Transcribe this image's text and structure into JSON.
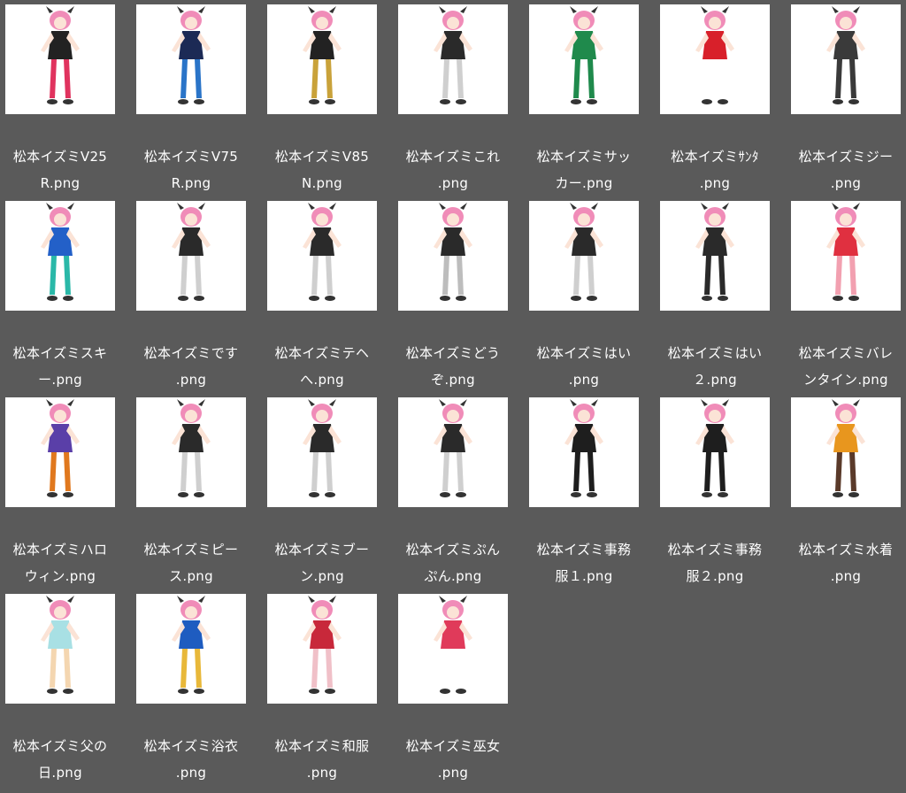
{
  "files": [
    {
      "line1": "松本イズミV25",
      "line2": "R.png",
      "icon": "character-illustration-icon",
      "hair": "#f08cb8",
      "outfit": "#222222",
      "accent": "#e0335e",
      "bg": "#ffffff"
    },
    {
      "line1": "松本イズミV75",
      "line2": "R.png",
      "icon": "character-illustration-icon",
      "hair": "#f08cb8",
      "outfit": "#1c2a55",
      "accent": "#2a74c8",
      "bg": "#ffffff"
    },
    {
      "line1": "松本イズミV85",
      "line2": "N.png",
      "icon": "character-illustration-icon",
      "hair": "#f08cb8",
      "outfit": "#222222",
      "accent": "#c9a23a",
      "bg": "#ffffff"
    },
    {
      "line1": "松本イズミこれ",
      "line2": ".png",
      "icon": "character-illustration-icon",
      "hair": "#f08cb8",
      "outfit": "#2a2a2a",
      "accent": "#cfcfcf",
      "bg": "#ffffff"
    },
    {
      "line1": "松本イズミサッ",
      "line2": "カー.png",
      "icon": "character-illustration-icon",
      "hair": "#f08cb8",
      "outfit": "#1f8a4c",
      "accent": "#1f8a4c",
      "bg": "#ffffff"
    },
    {
      "line1": "松本イズミｻﾝﾀ",
      "line2": ".png",
      "icon": "character-illustration-icon",
      "hair": "#f08cb8",
      "outfit": "#d8202a",
      "accent": "#ffffff",
      "bg": "#ffffff"
    },
    {
      "line1": "松本イズミジー",
      "line2": ".png",
      "icon": "character-illustration-icon",
      "hair": "#f08cb8",
      "outfit": "#3a3a3a",
      "accent": "#3a3a3a",
      "bg": "#ffffff"
    },
    {
      "line1": "松本イズミスキ",
      "line2": "ー.png",
      "icon": "character-illustration-icon",
      "hair": "#f08cb8",
      "outfit": "#2360c8",
      "accent": "#2ab8a8",
      "bg": "#ffffff"
    },
    {
      "line1": "松本イズミです",
      "line2": ".png",
      "icon": "character-illustration-icon",
      "hair": "#f08cb8",
      "outfit": "#2a2a2a",
      "accent": "#cfcfcf",
      "bg": "#ffffff"
    },
    {
      "line1": "松本イズミテヘ",
      "line2": "へ.png",
      "icon": "character-illustration-icon",
      "hair": "#f08cb8",
      "outfit": "#2a2a2a",
      "accent": "#cfcfcf",
      "bg": "#ffffff"
    },
    {
      "line1": "松本イズミどう",
      "line2": "ぞ.png",
      "icon": "character-illustration-icon",
      "hair": "#f08cb8",
      "outfit": "#2a2a2a",
      "accent": "#bdbdbd",
      "bg": "#ffffff"
    },
    {
      "line1": "松本イズミはい",
      "line2": ".png",
      "icon": "character-illustration-icon",
      "hair": "#f08cb8",
      "outfit": "#2a2a2a",
      "accent": "#cfcfcf",
      "bg": "#ffffff"
    },
    {
      "line1": "松本イズミはい",
      "line2": "２.png",
      "icon": "character-illustration-icon",
      "hair": "#f08cb8",
      "outfit": "#2a2a2a",
      "accent": "#2a2a2a",
      "bg": "#ffffff"
    },
    {
      "line1": "松本イズミバレ",
      "line2": "ンタイン.png",
      "icon": "character-illustration-icon",
      "hair": "#f08cb8",
      "outfit": "#e03040",
      "accent": "#f2a0b0",
      "bg": "#ffffff"
    },
    {
      "line1": "松本イズミハロ",
      "line2": "ウィン.png",
      "icon": "character-illustration-icon",
      "hair": "#f08cb8",
      "outfit": "#5a3fa8",
      "accent": "#e0781e",
      "bg": "#ffffff"
    },
    {
      "line1": "松本イズミピー",
      "line2": "ス.png",
      "icon": "character-illustration-icon",
      "hair": "#f08cb8",
      "outfit": "#2a2a2a",
      "accent": "#cfcfcf",
      "bg": "#ffffff"
    },
    {
      "line1": "松本イズミブー",
      "line2": "ン.png",
      "icon": "character-illustration-icon",
      "hair": "#f08cb8",
      "outfit": "#2a2a2a",
      "accent": "#cfcfcf",
      "bg": "#ffffff"
    },
    {
      "line1": "松本イズミぷん",
      "line2": "ぷん.png",
      "icon": "character-illustration-icon",
      "hair": "#f08cb8",
      "outfit": "#2a2a2a",
      "accent": "#cfcfcf",
      "bg": "#ffffff"
    },
    {
      "line1": "松本イズミ事務",
      "line2": "服１.png",
      "icon": "character-illustration-icon",
      "hair": "#f08cb8",
      "outfit": "#1e1e1e",
      "accent": "#1e1e1e",
      "bg": "#ffffff"
    },
    {
      "line1": "松本イズミ事務",
      "line2": "服２.png",
      "icon": "character-illustration-icon",
      "hair": "#f08cb8",
      "outfit": "#1e1e1e",
      "accent": "#1e1e1e",
      "bg": "#ffffff"
    },
    {
      "line1": "松本イズミ水着",
      "line2": ".png",
      "icon": "character-illustration-icon",
      "hair": "#f08cb8",
      "outfit": "#e8961e",
      "accent": "#5a3a2a",
      "bg": "#ffffff"
    },
    {
      "line1": "松本イズミ父の",
      "line2": "日.png",
      "icon": "character-illustration-icon",
      "hair": "#f08cb8",
      "outfit": "#a8e0e4",
      "accent": "#f4d6b0",
      "bg": "#ffffff"
    },
    {
      "line1": "松本イズミ浴衣",
      "line2": ".png",
      "icon": "character-illustration-icon",
      "hair": "#f08cb8",
      "outfit": "#1e5cc0",
      "accent": "#e8b83a",
      "bg": "#ffffff"
    },
    {
      "line1": "松本イズミ和服",
      "line2": ".png",
      "icon": "character-illustration-icon",
      "hair": "#f08cb8",
      "outfit": "#c8283a",
      "accent": "#f0c0c8",
      "bg": "#ffffff"
    },
    {
      "line1": "松本イズミ巫女",
      "line2": ".png",
      "icon": "character-illustration-icon",
      "hair": "#f08cb8",
      "outfit": "#e03a5a",
      "accent": "#ffffff",
      "bg": "#ffffff"
    }
  ]
}
